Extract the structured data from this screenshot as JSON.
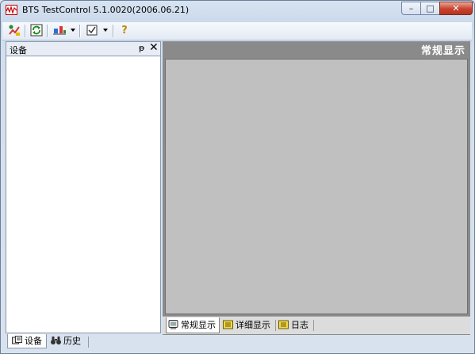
{
  "window": {
    "title": "BTS TestControl 5.1.0020(2006.06.21)"
  },
  "controls": {
    "minimize": "–",
    "maximize": "□",
    "close": "✕"
  },
  "toolbar": {
    "icons": [
      "connect-icon",
      "refresh-icon",
      "device-tool-icon",
      "checklist-icon",
      "help-icon"
    ],
    "help_glyph": "?"
  },
  "left_panel": {
    "title": "设备",
    "pin": "ᵽ",
    "close": "✕"
  },
  "left_tabs": [
    {
      "label": "设备"
    },
    {
      "label": "历史"
    }
  ],
  "right_panel": {
    "caption": "常规显示"
  },
  "right_tabs": [
    {
      "label": "常规显示"
    },
    {
      "label": "详细显示"
    },
    {
      "label": "日志"
    }
  ],
  "colors": {
    "title_accent": "#c0392b",
    "view_bg": "#c0c0c0",
    "header_bg": "#8a8a8a"
  }
}
